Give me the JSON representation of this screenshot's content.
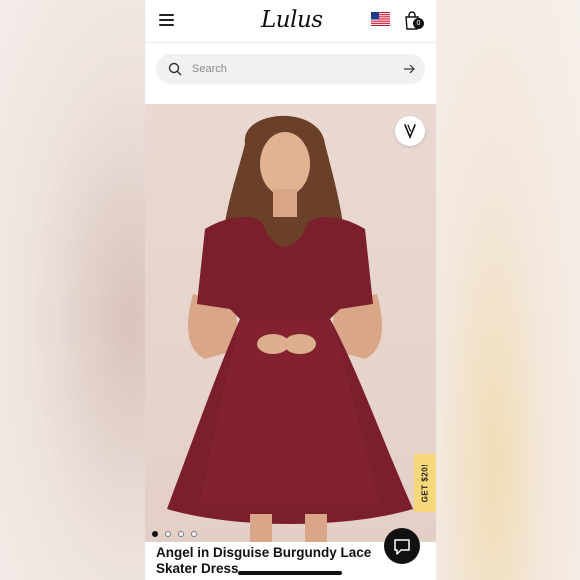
{
  "header": {
    "logo": "Lulus",
    "menu_icon": "hamburger-menu-icon",
    "flag_icon": "us-flag-icon",
    "bag_icon": "shopping-bag-icon",
    "bag_count": "0"
  },
  "search": {
    "placeholder": "Search",
    "icon": "search-icon",
    "submit_icon": "arrow-right-icon"
  },
  "product": {
    "title": "Angel in Disguise Burgundy Lace Skater Dress",
    "image_dots": 4,
    "active_dot": 1,
    "dress_color": "#7a1f2b"
  },
  "promo": {
    "label": "GET $20!",
    "color": "#f6d77a"
  },
  "favorite_icon": "heart-check-icon",
  "chat_icon": "chat-bubble-icon"
}
